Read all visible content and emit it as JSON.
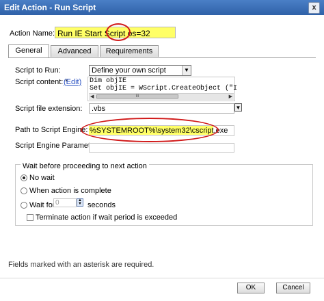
{
  "window": {
    "title": "Edit Action - Run Script",
    "close_glyph": "x"
  },
  "action_name": {
    "label": "Action Name: *",
    "value": "Run IE Start Script os=32"
  },
  "tabs": [
    {
      "label": "General",
      "active": true
    },
    {
      "label": "Advanced",
      "active": false
    },
    {
      "label": "Requirements",
      "active": false
    }
  ],
  "general": {
    "script_to_run": {
      "label": "Script to Run:",
      "value": "Define your own script",
      "arrow": "▼"
    },
    "script_content": {
      "label": "Script content: *",
      "edit_link": "(Edit)",
      "lines": [
        "Dim objIE",
        "Set objIE = WScript.CreateObject (\"I"
      ],
      "scroll_thumb": "III"
    },
    "extension": {
      "label": "Script file extension:",
      "value": ".vbs",
      "expand_glyph": "▼"
    },
    "engine_path": {
      "label": "Path to Script Engine:",
      "value": "%SYSTEMROOT%\\system32\\cscript.exe"
    },
    "engine_params": {
      "label": "Script Engine Parameters:",
      "value": ""
    }
  },
  "wait": {
    "title": "Wait before proceeding to next action",
    "options": [
      {
        "label": "No wait",
        "selected": true
      },
      {
        "label": "When action is complete",
        "selected": false
      },
      {
        "label": "Wait for",
        "selected": false
      }
    ],
    "wait_for_value": "0",
    "wait_for_unit": "seconds",
    "terminate_label": "Terminate action if wait period is exceeded",
    "terminate_checked": false
  },
  "footer": {
    "note": "Fields marked with an asterisk are required.",
    "ok_label": "OK",
    "cancel_label": "Cancel"
  },
  "colors": {
    "title_bar": "#3a6db5",
    "highlight": "#ffff66",
    "annotation": "#d11a1a"
  }
}
